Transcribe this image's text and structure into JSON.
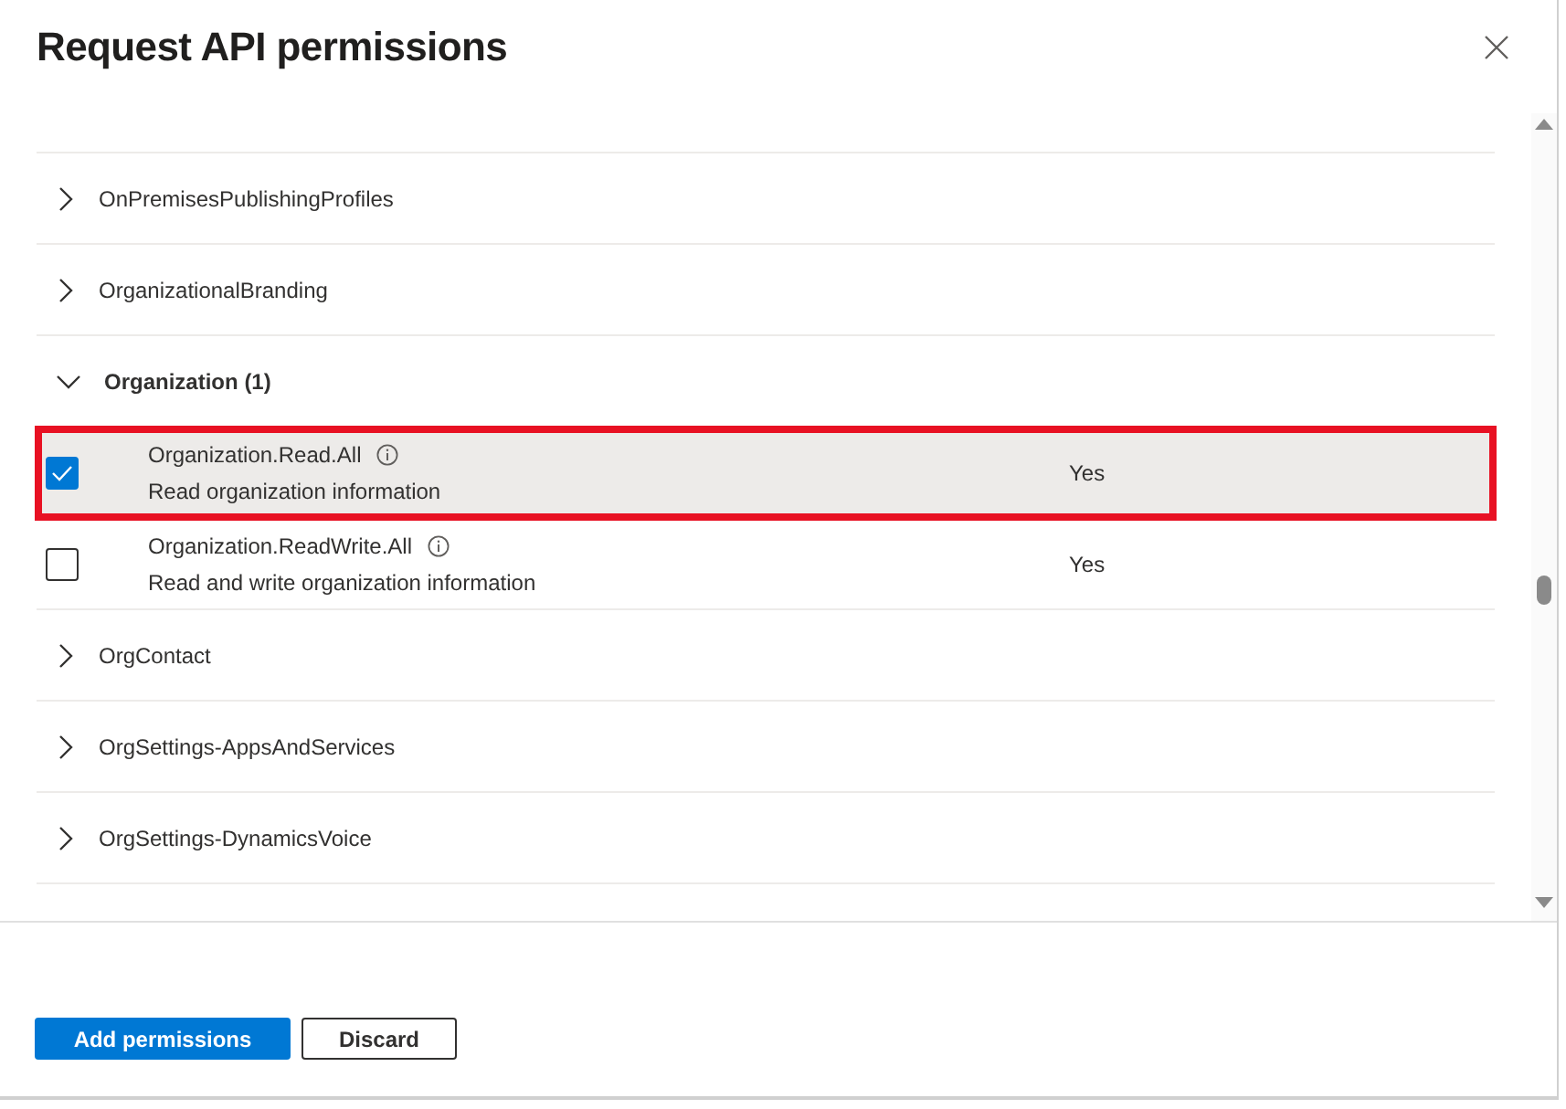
{
  "dialog": {
    "title": "Request API permissions"
  },
  "groups": [
    {
      "name": "OnPremisesPublishingProfiles",
      "expanded": false
    },
    {
      "name": "OrganizationalBranding",
      "expanded": false
    },
    {
      "name": "Organization",
      "count": "(1)",
      "expanded": true,
      "permissions": [
        {
          "name": "Organization.Read.All",
          "description": "Read organization information",
          "admin_consent": "Yes",
          "checked": true,
          "selected": true,
          "highlighted": true
        },
        {
          "name": "Organization.ReadWrite.All",
          "description": "Read and write organization information",
          "admin_consent": "Yes",
          "checked": false,
          "selected": false,
          "highlighted": false
        }
      ]
    },
    {
      "name": "OrgContact",
      "expanded": false
    },
    {
      "name": "OrgSettings-AppsAndServices",
      "expanded": false
    },
    {
      "name": "OrgSettings-DynamicsVoice",
      "expanded": false
    }
  ],
  "buttons": [
    {
      "label": "Add permissions",
      "kind": "primary"
    },
    {
      "label": "Discard",
      "kind": "secondary"
    }
  ]
}
